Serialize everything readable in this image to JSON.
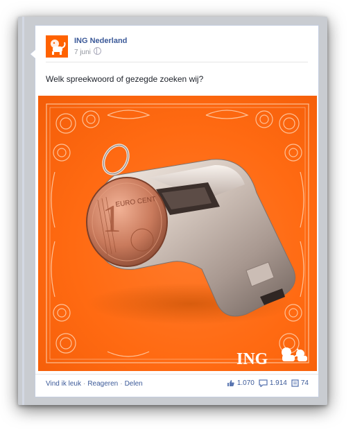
{
  "post": {
    "author": "ING Nederland",
    "date": "7 juni",
    "message": "Welk spreekwoord of gezegde zoeken wij?",
    "image": {
      "logo_text": "ING",
      "coin_text": "1 EURO CENT"
    },
    "actions": {
      "like": "Vind ik leuk",
      "comment": "Reageren",
      "share": "Delen"
    },
    "stats": {
      "likes": "1.070",
      "comments": "1.914",
      "shares": "74"
    }
  },
  "colors": {
    "brand_orange": "#ff6200",
    "link_blue": "#3b5998"
  },
  "icons": [
    "globe-icon",
    "thumbs-up-icon",
    "comment-icon",
    "share-icon",
    "lion-icon"
  ]
}
